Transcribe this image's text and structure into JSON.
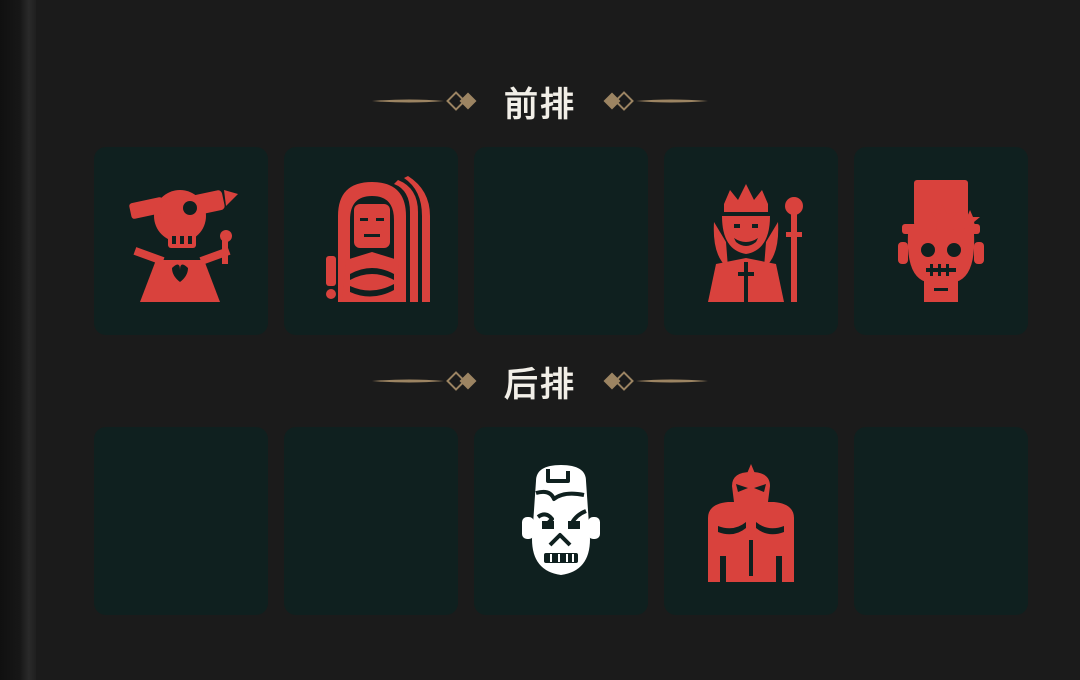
{
  "colors": {
    "background": "#1b1b1b",
    "slot_background": "#0f201f",
    "enemy_red": "#d9423d",
    "ally_white": "#ffffff",
    "ornament_gold": "#9c8462",
    "title_text": "#f2efe8"
  },
  "front_row": {
    "title": "前排",
    "slots": [
      {
        "occupied": true,
        "icon": "telescope-scarecrow-icon",
        "color": "red"
      },
      {
        "occupied": true,
        "icon": "pharaoh-mummy-icon",
        "color": "red"
      },
      {
        "occupied": false,
        "icon": "",
        "color": ""
      },
      {
        "occupied": true,
        "icon": "king-with-scepter-icon",
        "color": "red"
      },
      {
        "occupied": true,
        "icon": "top-hat-zombie-icon",
        "color": "red"
      }
    ]
  },
  "back_row": {
    "title": "后排",
    "slots": [
      {
        "occupied": false,
        "icon": "",
        "color": ""
      },
      {
        "occupied": false,
        "icon": "",
        "color": ""
      },
      {
        "occupied": true,
        "icon": "cracked-skull-icon",
        "color": "white"
      },
      {
        "occupied": true,
        "icon": "masked-wrestler-icon",
        "color": "red"
      },
      {
        "occupied": false,
        "icon": "",
        "color": ""
      }
    ]
  }
}
